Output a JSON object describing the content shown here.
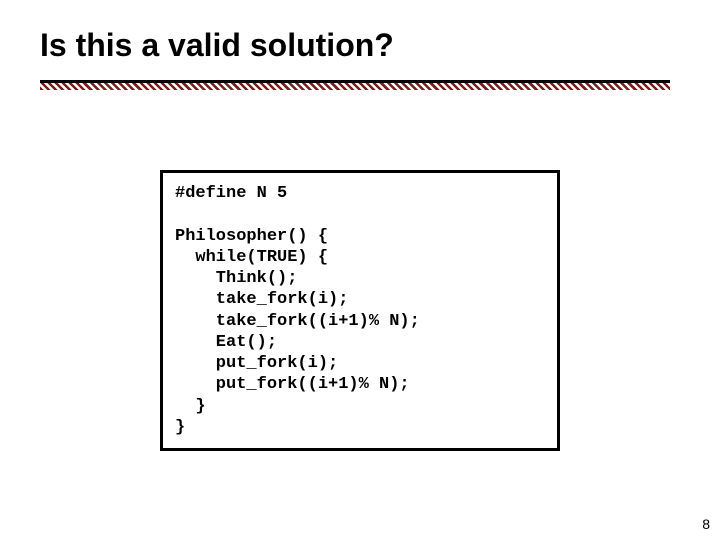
{
  "slide": {
    "title": "Is this a valid solution?",
    "page_number": "8"
  },
  "code": {
    "lines": [
      "#define N 5",
      "",
      "Philosopher() {",
      "  while(TRUE) {",
      "    Think();",
      "    take_fork(i);",
      "    take_fork((i+1)% N);",
      "    Eat();",
      "    put_fork(i);",
      "    put_fork((i+1)% N);",
      "  }",
      "}"
    ]
  }
}
